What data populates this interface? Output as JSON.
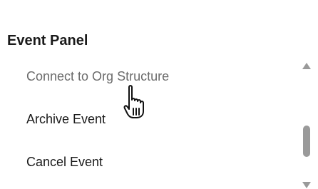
{
  "panel": {
    "title": "Event Panel",
    "items": [
      {
        "label": "Connect to Org Structure",
        "state": "hover"
      },
      {
        "label": "Archive Event"
      },
      {
        "label": "Cancel Event"
      }
    ]
  },
  "icons": {
    "cursor": "hand-pointer-icon",
    "scroll_up": "scroll-up-arrow-icon",
    "scroll_down": "scroll-down-arrow-icon"
  },
  "colors": {
    "title": "#1a1a1a",
    "item_text": "#1a1a1a",
    "item_hover_text": "#6b6b6b",
    "scrollbar": "#9a9a9a"
  }
}
